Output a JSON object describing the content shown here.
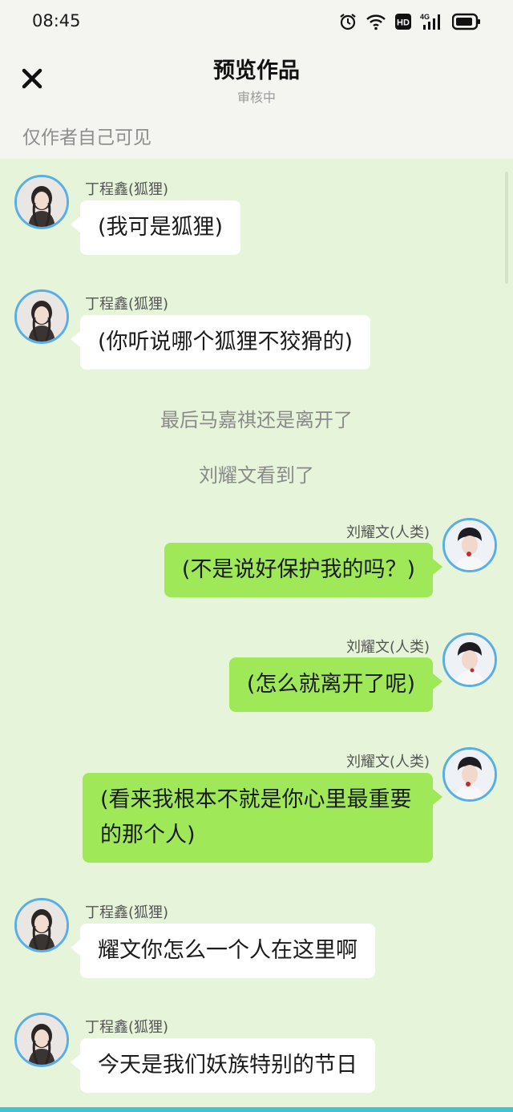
{
  "status_bar": {
    "time": "08:45",
    "icons": [
      "alarm-icon",
      "wifi-icon",
      "hd-icon",
      "signal-4g-icon",
      "battery-icon"
    ],
    "hd_label": "HD",
    "network_label": "4G"
  },
  "header": {
    "title": "预览作品",
    "subtitle": "审核中",
    "close_icon": "close-icon"
  },
  "visibility_note": "仅作者自己可见",
  "colors": {
    "chat_background": "#e6f4da",
    "right_bubble": "#9fe858",
    "left_bubble": "#ffffff",
    "avatar_border": "#5aaee6"
  },
  "messages": [
    {
      "type": "left",
      "name": "丁程鑫(狐狸)",
      "text": "(我可是狐狸)"
    },
    {
      "type": "left",
      "name": "丁程鑫(狐狸)",
      "text": "(你听说哪个狐狸不狡猾的)"
    },
    {
      "type": "narration",
      "text": "最后马嘉祺还是离开了"
    },
    {
      "type": "narration",
      "text": "刘耀文看到了"
    },
    {
      "type": "right",
      "name": "刘耀文(人类)",
      "text": "(不是说好保护我的吗？)"
    },
    {
      "type": "right",
      "name": "刘耀文(人类)",
      "text": "(怎么就离开了呢)"
    },
    {
      "type": "right",
      "name": "刘耀文(人类)",
      "text": "(看来我根本不就是你心里最重要的那个人)"
    },
    {
      "type": "left",
      "name": "丁程鑫(狐狸)",
      "text": "耀文你怎么一个人在这里啊"
    },
    {
      "type": "left",
      "name": "丁程鑫(狐狸)",
      "text": "今天是我们妖族特别的节日"
    }
  ]
}
